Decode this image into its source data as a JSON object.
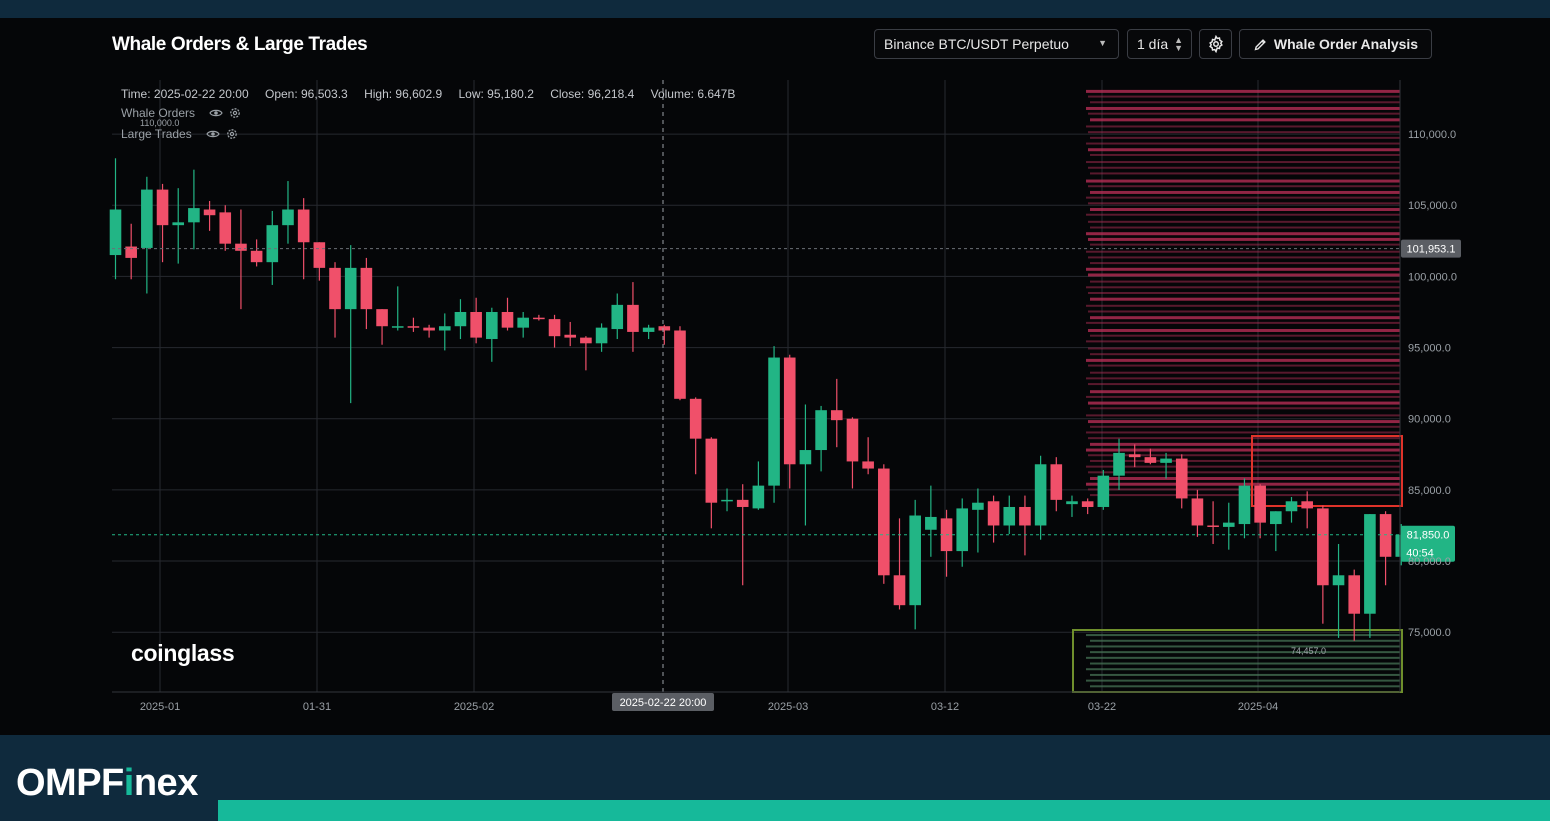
{
  "header": {
    "title": "Whale Orders & Large Trades",
    "symbol_select": "Binance BTC/USDT Perpetuo",
    "interval_select": "1 día",
    "analysis_button": "Whale Order Analysis",
    "icons": {
      "caret": "chevron-down-icon",
      "interval": "updown-icon",
      "settings": "gear-icon",
      "analysis": "pencil-icon"
    }
  },
  "legend": {
    "time": "Time: 2025-02-22 20:00",
    "open": "Open: 96,503.3",
    "high": "High: 96,602.9",
    "low": "Low: 95,180.2",
    "close": "Close: 96,218.4",
    "volume": "Volume: 6.647B",
    "indicators": [
      {
        "label": "Whale Orders",
        "icons": [
          "eye-icon",
          "gear-icon"
        ]
      },
      {
        "label": "Large Trades",
        "icons": [
          "eye-icon",
          "gear-icon"
        ]
      }
    ],
    "sub_value": "110,000.0"
  },
  "watermark": "coinglass",
  "brand": {
    "prefix": "OMPF",
    "accent": "i",
    "suffix": "nex"
  },
  "colors": {
    "up": "#22b585",
    "down": "#f0506a",
    "bid_wall": "#4a7a5a",
    "ask_wall": "#c2305a",
    "ask_highlight_box": "#e0332a",
    "bid_highlight_box": "#6f8f2c",
    "brand_accent": "#16b99a"
  },
  "chart_data": {
    "type": "candlestick",
    "price_axis": {
      "ticks": [
        75000,
        80000,
        85000,
        90000,
        95000,
        100000,
        105000,
        110000
      ],
      "tick_labels": [
        "75,000.0",
        "80,000.0",
        "85,000.0",
        "90,000.0",
        "95,000.0",
        "100,000.0",
        "105,000.0",
        "110,000.0"
      ],
      "range": [
        70800,
        113800
      ]
    },
    "time_axis": {
      "labels": [
        "2025-01",
        "01-31",
        "2025-02",
        "2025-03",
        "03-12",
        "03-22",
        "2025-04"
      ],
      "crosshair_label": "2025-02-22 20:00"
    },
    "markers": {
      "last_price": 81850,
      "last_price_label": "81,850.0",
      "countdown": "40:54",
      "high_line": 101953.1,
      "high_line_label": "101,953.1",
      "crosshair_price": 101953.1,
      "level_note": "74,457.0"
    },
    "candles": [
      [
        101500,
        108300,
        99800,
        104700
      ],
      [
        102100,
        103700,
        99800,
        101300
      ],
      [
        102000,
        107000,
        98800,
        106100
      ],
      [
        106100,
        106500,
        101000,
        103600
      ],
      [
        103600,
        106200,
        100900,
        103800
      ],
      [
        103800,
        107500,
        101900,
        104800
      ],
      [
        104700,
        105300,
        103200,
        104300
      ],
      [
        104500,
        105000,
        101800,
        102300
      ],
      [
        102300,
        104700,
        97700,
        101800
      ],
      [
        101800,
        102600,
        100700,
        101000
      ],
      [
        101000,
        104600,
        99400,
        103600
      ],
      [
        103600,
        106700,
        102300,
        104700
      ],
      [
        104700,
        105500,
        99800,
        102400
      ],
      [
        102400,
        102400,
        99700,
        100600
      ],
      [
        100600,
        101000,
        95700,
        97700
      ],
      [
        97700,
        102200,
        91100,
        100600
      ],
      [
        100600,
        101300,
        96300,
        97700
      ],
      [
        97700,
        97700,
        95200,
        96500
      ],
      [
        96500,
        99300,
        96200,
        96500
      ],
      [
        96500,
        97100,
        96100,
        96400
      ],
      [
        96400,
        96600,
        95700,
        96200
      ],
      [
        96200,
        97400,
        94800,
        96500
      ],
      [
        96500,
        98400,
        95600,
        97500
      ],
      [
        97500,
        98500,
        95300,
        95700
      ],
      [
        95600,
        97800,
        94000,
        97500
      ],
      [
        97500,
        98500,
        96200,
        96400
      ],
      [
        96400,
        97500,
        95700,
        97100
      ],
      [
        97100,
        97300,
        96900,
        97000
      ],
      [
        97000,
        97300,
        95000,
        95800
      ],
      [
        95900,
        96800,
        95100,
        95700
      ],
      [
        95700,
        95800,
        93400,
        95300
      ],
      [
        95300,
        96700,
        94700,
        96400
      ],
      [
        96300,
        98800,
        95600,
        98000
      ],
      [
        98000,
        99600,
        94700,
        96100
      ],
      [
        96100,
        96600,
        95600,
        96400
      ],
      [
        96500,
        96600,
        95200,
        96200
      ],
      [
        96200,
        96500,
        91300,
        91400
      ],
      [
        91400,
        91500,
        86100,
        88600
      ],
      [
        88600,
        88700,
        82300,
        84100
      ],
      [
        84200,
        85100,
        83500,
        84300
      ],
      [
        84300,
        85400,
        78300,
        83800
      ],
      [
        83700,
        87000,
        83600,
        85300
      ],
      [
        85300,
        95100,
        84100,
        94300
      ],
      [
        94300,
        94500,
        85100,
        86800
      ],
      [
        86800,
        91000,
        82500,
        87800
      ],
      [
        87800,
        90900,
        86300,
        90600
      ],
      [
        90600,
        92800,
        88000,
        89900
      ],
      [
        90000,
        90100,
        85100,
        87000
      ],
      [
        87000,
        88700,
        86100,
        86500
      ],
      [
        86500,
        86800,
        78400,
        79000
      ],
      [
        79000,
        83000,
        76600,
        76900
      ],
      [
        76900,
        84300,
        75200,
        83200
      ],
      [
        82200,
        85300,
        80300,
        83100
      ],
      [
        83000,
        83600,
        78900,
        80700
      ],
      [
        80700,
        84400,
        79600,
        83700
      ],
      [
        83600,
        85100,
        80600,
        84100
      ],
      [
        84200,
        84600,
        81300,
        82500
      ],
      [
        82500,
        84600,
        81900,
        83800
      ],
      [
        83800,
        84600,
        80400,
        82500
      ],
      [
        82500,
        87400,
        81500,
        86800
      ],
      [
        86800,
        87300,
        83500,
        84300
      ],
      [
        84000,
        84600,
        83100,
        84200
      ],
      [
        84200,
        84400,
        83300,
        83800
      ],
      [
        83800,
        86400,
        83600,
        86000
      ],
      [
        86000,
        88600,
        85000,
        87600
      ],
      [
        87500,
        88200,
        86600,
        87300
      ],
      [
        87300,
        87900,
        86800,
        86900
      ],
      [
        86900,
        87600,
        85800,
        87200
      ],
      [
        87200,
        87500,
        83700,
        84400
      ],
      [
        84400,
        85000,
        81700,
        82500
      ],
      [
        82500,
        84200,
        81200,
        82400
      ],
      [
        82400,
        84100,
        80800,
        82700
      ],
      [
        82600,
        85800,
        81600,
        85300
      ],
      [
        85300,
        85400,
        81600,
        82700
      ],
      [
        82600,
        83500,
        80700,
        83500
      ],
      [
        83500,
        84500,
        82700,
        84200
      ],
      [
        84200,
        84900,
        82300,
        83700
      ],
      [
        83700,
        83900,
        75600,
        78300
      ],
      [
        78300,
        81200,
        74600,
        79000
      ],
      [
        79000,
        79400,
        74400,
        76300
      ],
      [
        76300,
        83300,
        74600,
        83300
      ],
      [
        83300,
        83500,
        78300,
        80300
      ],
      [
        80300,
        82600,
        79700,
        81850
      ]
    ],
    "order_walls": {
      "ask_levels": [
        113000,
        112600,
        112200,
        111800,
        111400,
        111000,
        110500,
        110100,
        109700,
        109300,
        108900,
        108500,
        108000,
        107600,
        107200,
        106700,
        106300,
        105900,
        105500,
        105100,
        104700,
        104300,
        103800,
        103400,
        103000,
        102600,
        102200,
        101700,
        101300,
        100900,
        100500,
        100100,
        99600,
        99200,
        98800,
        98400,
        97900,
        97500,
        97100,
        96700,
        96200,
        95800,
        95400,
        94900,
        94500,
        94100,
        93700,
        93200,
        92800,
        92400,
        91900,
        91500,
        91100,
        90700,
        90200,
        89800,
        89400,
        89000,
        88600,
        88200,
        87800,
        87400,
        87000,
        86600,
        86200,
        85800,
        85400,
        85000,
        84600
      ],
      "bid_levels": [
        74800,
        74400,
        74000,
        73600,
        73200,
        72800,
        72400,
        72000,
        71600,
        71200
      ]
    }
  }
}
